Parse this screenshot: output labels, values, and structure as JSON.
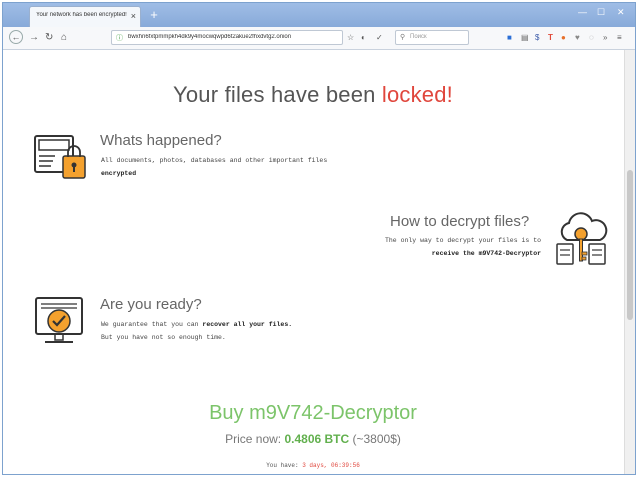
{
  "browser": {
    "tab_title": "Your network has been encrypted!",
    "tab_close": "×",
    "new_tab": "+",
    "url": "bwxhn6fxtpmmpkh4dk9y4mocwqwpd6t2akue2fhxdvtg2.onion",
    "search_placeholder": "Поиск",
    "window_minimize": "—",
    "window_maximize": "☐",
    "window_close": "✕"
  },
  "page": {
    "headline_prefix": "Your files have been ",
    "headline_highlight": "locked",
    "headline_suffix": "!",
    "sections": [
      {
        "title": "Whats happened?",
        "line1": "All documents, photos, databases and other important files",
        "line2_bold": "encrypted",
        "icon": "locked-computer-icon"
      },
      {
        "title": "How to decrypt files?",
        "line1": "The only way to decrypt your files is to",
        "line2_bold": "receive the m9V742-Decryptor",
        "icon": "cloud-key-icon"
      },
      {
        "title": "Are you ready?",
        "line1_a": "We guarantee that you can ",
        "line1_b": "recover all your files.",
        "line2": "But you have not so enough time.",
        "icon": "monitor-check-icon"
      }
    ],
    "buy_title": "Buy m9V742-Decryptor",
    "price_label": "Price now: ",
    "price_btc": "0.4806 BTC",
    "price_usd": " (~3800$)",
    "timer_label": "You have: ",
    "timer_value": "3 days, 06:39:56"
  },
  "colors": {
    "accent_red": "#e0463c",
    "accent_green": "#7cc46a",
    "icon_orange": "#f4a12e"
  }
}
